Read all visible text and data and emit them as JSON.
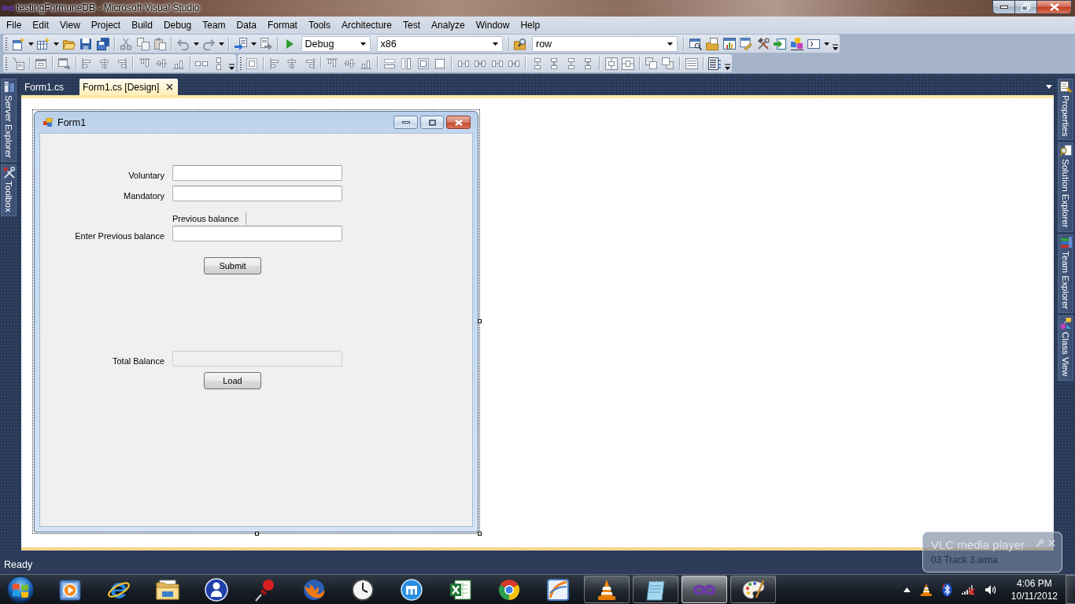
{
  "window": {
    "title": "testingFormuneDB - Microsoft Visual Studio"
  },
  "menu_bar": [
    "File",
    "Edit",
    "View",
    "Project",
    "Build",
    "Debug",
    "Team",
    "Data",
    "Format",
    "Tools",
    "Architecture",
    "Test",
    "Analyze",
    "Window",
    "Help"
  ],
  "toolbar": {
    "configuration": "Debug",
    "platform": "x86",
    "find": "row"
  },
  "left_dock": [
    "Server Explorer",
    "Toolbox"
  ],
  "document_tabs": [
    {
      "label": "Form1.cs",
      "selected": false
    },
    {
      "label": "Form1.cs [Design]",
      "selected": true
    }
  ],
  "designer_form": {
    "title": "Form1",
    "controls": [
      {
        "kind": "textbox",
        "label": "Voluntary",
        "disabled": false
      },
      {
        "kind": "textbox",
        "label": "Mandatory",
        "disabled": false
      },
      {
        "kind": "caption",
        "text": "Previous balance"
      },
      {
        "kind": "textbox",
        "label": "Enter Previous balance",
        "disabled": false
      },
      {
        "kind": "button",
        "label": "Submit"
      },
      {
        "kind": "textbox",
        "label": "Total Balance",
        "disabled": true
      },
      {
        "kind": "button",
        "label": "Load"
      }
    ]
  },
  "right_dock": [
    "Properties",
    "Solution Explorer",
    "Team Explorer",
    "Class View"
  ],
  "status_bar": {
    "text": "Ready"
  },
  "notification": {
    "title": "VLC media player",
    "message": "03 Track 3.wma"
  },
  "taskbar": {
    "windows": [
      {
        "selected": false
      },
      {
        "selected": false
      },
      {
        "selected": true
      },
      {
        "selected": false
      }
    ],
    "clock": {
      "time": "4:06 PM",
      "date": "10/11/2012"
    }
  }
}
